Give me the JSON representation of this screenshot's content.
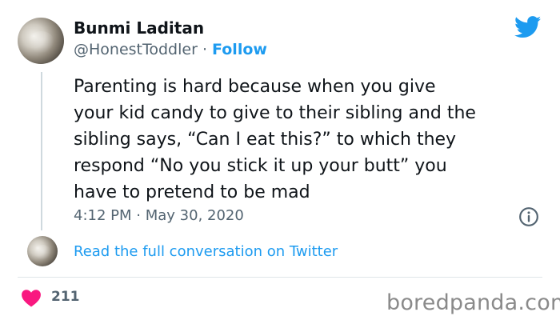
{
  "tweet": {
    "author_name": "Bunmi Laditan",
    "handle": "@HonestToddler",
    "separator": "·",
    "follow_label": "Follow",
    "text": "Parenting is hard because when you give\nyour kid candy to give to their sibling and the\nsibling says, “Can I eat this?” to which they\nrespond “No you stick it up your butt” you\nhave to pretend to be mad",
    "time": "4:12 PM",
    "date": "May 30, 2020",
    "read_more_label": "Read the full conversation on Twitter",
    "like_count": "211"
  },
  "watermark": "boredpanda.com",
  "icons": {
    "brand": "twitter-bird-icon",
    "info": "info-icon",
    "like": "heart-icon"
  },
  "colors": {
    "accent": "#1d9bf0",
    "text": "#0f1419",
    "secondary": "#536471",
    "heart": "#f91880"
  }
}
